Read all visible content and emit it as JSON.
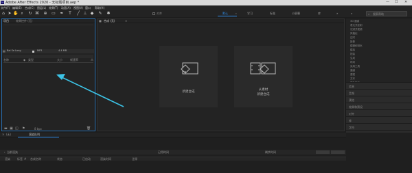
{
  "window": {
    "title": "Adobe After Effects 2020 - 无标题项目.aep *",
    "minimize": "—",
    "maximize": "☐",
    "close": "✕"
  },
  "menu": {
    "items": [
      "文件(F)",
      "编辑(E)",
      "合成(C)",
      "图层(L)",
      "效果(T)",
      "动画(A)",
      "视图(V)",
      "窗口",
      "帮助(H)"
    ]
  },
  "toolbar": {
    "workspaces": [
      "默认",
      "学习",
      "标准",
      "小屏幕",
      "库"
    ],
    "active_workspace": "默认",
    "search_placeholder": "搜索帮助",
    "snap_label": "对齐"
  },
  "project_panel": {
    "tabs": [
      "项目",
      "效果控件 (无)"
    ],
    "columns": [
      "名称",
      "类型",
      "大小",
      "帧速率"
    ],
    "file": {
      "name": "Bai Se Long",
      "type": "MP3",
      "size": "4.4 MB"
    },
    "bpc": "8 bpc"
  },
  "comp_panel": {
    "tab": "合成 (无)",
    "new_comp_label": "新建合成",
    "from_footage_line1": "从素材",
    "from_footage_line2": "新建合成"
  },
  "right_panel": {
    "effects_list": [
      "3D 通道",
      "表达式控制",
      "沉浸式视频",
      "风格化",
      "过时",
      "抠像",
      "模糊和锐化",
      "模拟",
      "扭曲",
      "生成",
      "时间",
      "实用工具",
      "通道",
      "透视",
      "文本",
      "颜色校正",
      "音频",
      "杂色和颗粒",
      "遮罩"
    ],
    "sections": [
      "信息",
      "音频",
      "预览",
      "效果和预设",
      "对齐",
      "库",
      "字符",
      "段落",
      "跟踪器",
      "内容识别填充"
    ]
  },
  "timeline": {
    "tabs": [
      "(无)",
      "渲染队列"
    ],
    "render_row": [
      "当前渲染",
      "已用时间",
      "剩余时间"
    ],
    "columns": [
      "渲染",
      "标签",
      "#",
      "合成名称",
      "状态",
      "已启动",
      "渲染时间",
      "注释"
    ]
  },
  "colors": {
    "accent": "#2d8ceb",
    "annotation_arrow": "#3cc3e6"
  }
}
